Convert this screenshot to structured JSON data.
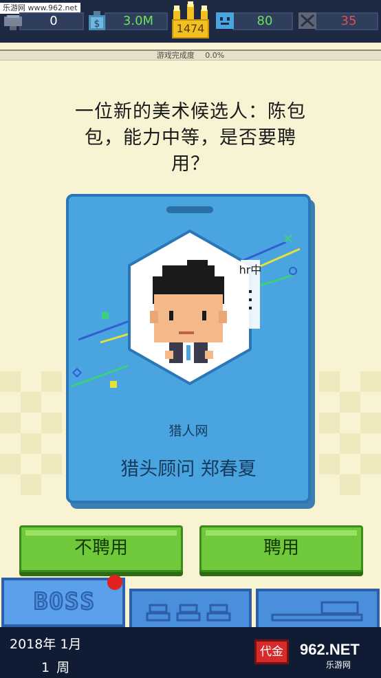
{
  "watermark": {
    "text": "乐游网 www.962.net"
  },
  "stats": {
    "trophy": "0",
    "money": "3.0M",
    "crown": "1474",
    "mood": "80",
    "error": "35"
  },
  "colors": {
    "money_text": "#6fe05a",
    "mood_text": "#6fe05a",
    "error_text": "#e05050",
    "trophy_text": "#ffffff"
  },
  "progress": {
    "label": "游戏完成度",
    "value": "0.0%"
  },
  "question": {
    "text": "一位新的美术候选人：陈包包，能力中等，是否要聘用？"
  },
  "card": {
    "company": "猎人网",
    "name": "猎头顾问 郑春夏",
    "badge": "hr中"
  },
  "buttons": {
    "decline": "不聘用",
    "hire": "聘用"
  },
  "tabs": {
    "boss_label": "BOSS"
  },
  "footer": {
    "date": "2018年 1月",
    "week_num": "1",
    "week_unit": "周",
    "chip": "代金"
  },
  "logo": {
    "big": "962.NET",
    "small": "乐游网"
  }
}
